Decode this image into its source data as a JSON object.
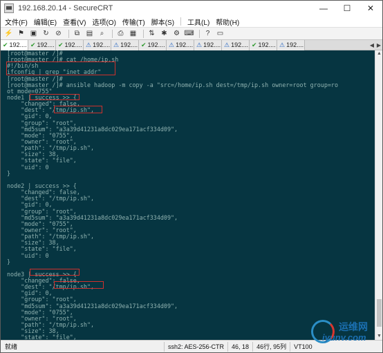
{
  "window": {
    "title": "192.168.20.14 - SecureCRT",
    "minimize": "—",
    "maximize": "☐",
    "close": "✕"
  },
  "menu": [
    "文件(F)",
    "编辑(E)",
    "查看(V)",
    "选项(O)",
    "传输(T)",
    "脚本(S)",
    "工具(L)",
    "帮助(H)"
  ],
  "tabs": [
    {
      "label": "192....",
      "icon": "✔",
      "state": "ok",
      "active": true
    },
    {
      "label": "192....",
      "icon": "✔",
      "state": "ok"
    },
    {
      "label": "192....",
      "icon": "✔",
      "state": "ok"
    },
    {
      "label": "192....",
      "icon": "⚠",
      "state": "warn"
    },
    {
      "label": "192....",
      "icon": "⚠",
      "state": "warn"
    },
    {
      "label": "192....",
      "icon": "✔",
      "state": "ok"
    },
    {
      "label": "192....",
      "icon": "⚠",
      "state": "warn"
    },
    {
      "label": "192....",
      "icon": "⚠",
      "state": "warn"
    },
    {
      "label": "192....",
      "icon": "⚠",
      "state": "warn"
    },
    {
      "label": "192....",
      "icon": "✔",
      "state": "ok"
    },
    {
      "label": "192....",
      "icon": "⚠",
      "state": "warn"
    }
  ],
  "terminal": {
    "lines": [
      "[root@master /]#",
      "[root@master /]# cat /home/ip.sh",
      "#!/bin/sh",
      "ifconfig | grep \"inet addr\"",
      "[root@master /]#",
      "[root@master /]# ansible hadoop -m copy -a \"src=/home/ip.sh dest=/tmp/ip.sh owner=root group=ro",
      "ot mode=0755\"",
      "node1 | success >> {",
      "    \"changed\": false,",
      "    \"dest\": \"/tmp/ip.sh\",",
      "    \"gid\": 0,",
      "    \"group\": \"root\",",
      "    \"md5sum\": \"a3a39d41231a8dc029ea171acf334d09\",",
      "    \"mode\": \"0755\",",
      "    \"owner\": \"root\",",
      "    \"path\": \"/tmp/ip.sh\",",
      "    \"size\": 38,",
      "    \"state\": \"file\",",
      "    \"uid\": 0",
      "}",
      "",
      "node2 | success >> {",
      "    \"changed\": false,",
      "    \"dest\": \"/tmp/ip.sh\",",
      "    \"gid\": 0,",
      "    \"group\": \"root\",",
      "    \"md5sum\": \"a3a39d41231a8dc029ea171acf334d09\",",
      "    \"mode\": \"0755\",",
      "    \"owner\": \"root\",",
      "    \"path\": \"/tmp/ip.sh\",",
      "    \"size\": 38,",
      "    \"state\": \"file\",",
      "    \"uid\": 0",
      "}",
      "",
      "node3 | success >> {",
      "    \"changed\": false,",
      "    \"dest\": \"/tmp/ip.sh\",",
      "    \"gid\": 0,",
      "    \"group\": \"root\",",
      "    \"md5sum\": \"a3a39d41231a8dc029ea171acf334d09\",",
      "    \"mode\": \"0755\",",
      "    \"owner\": \"root\",",
      "    \"path\": \"/tmp/ip.sh\",",
      "    \"size\": 38,",
      "    \"state\": \"file\","
    ],
    "background": "#063541",
    "text_color": "#8fb2b0",
    "highlight_color": "#d0312d"
  },
  "status": {
    "ready": "就绪",
    "cipher": "ssh2: AES-256-CTR",
    "cursor": "46, 18",
    "size": "46行, 95列",
    "term": "VT100"
  },
  "watermark": {
    "cn": "运维网",
    "url": "iyunv.com"
  }
}
